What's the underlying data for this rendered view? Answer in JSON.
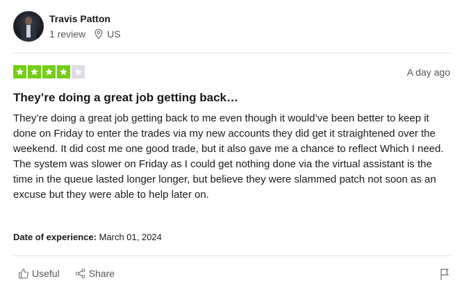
{
  "reviewer": {
    "name": "Travis Patton",
    "reviews": "1 review",
    "country": "US"
  },
  "rating": {
    "stars": 4,
    "max": 5,
    "color": "#73cf11",
    "empty_color": "#dcdce6"
  },
  "date_posted": "A day ago",
  "title": "They’re doing a great job getting back…",
  "body": "They’re doing a great job getting back to me even though it would’ve been better to keep it done on Friday to enter the trades via my new accounts they did get it straightened over the weekend. It did cost me one good trade, but it also gave me a chance to reflect Which I need. The system was slower on Friday as I could get nothing done via the virtual assistant is the time in the queue lasted longer longer, but believe they were slammed patch not soon as an excuse but they were able to help later on.",
  "experience": {
    "label": "Date of experience:",
    "value": "March 01, 2024"
  },
  "actions": {
    "useful": "Useful",
    "share": "Share"
  },
  "icons": [
    "avatar",
    "location-pin-icon",
    "star-icon",
    "thumbs-up-icon",
    "share-icon",
    "flag-icon"
  ]
}
